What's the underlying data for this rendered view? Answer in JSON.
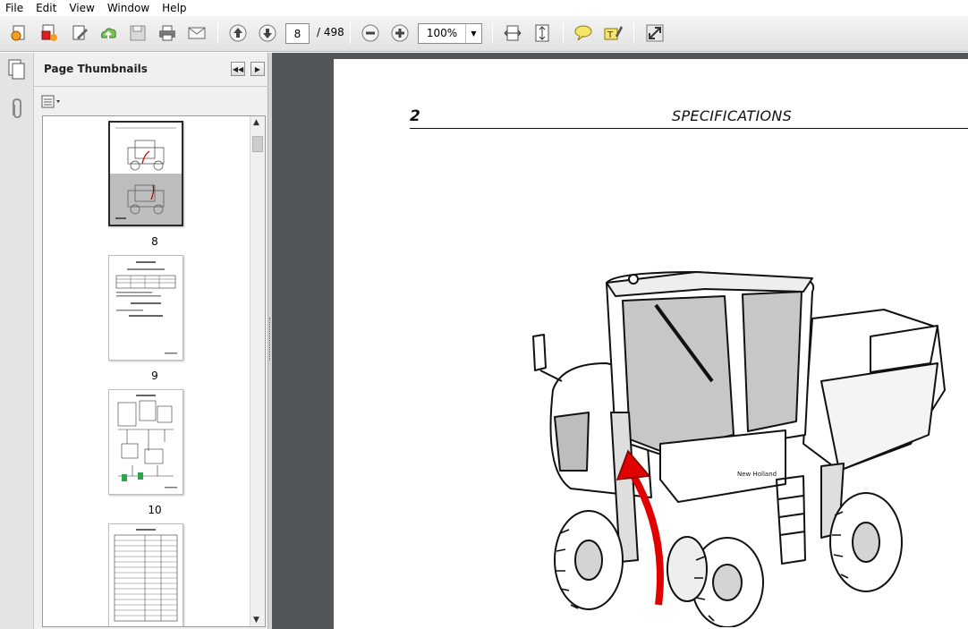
{
  "menu": [
    "File",
    "Edit",
    "View",
    "Window",
    "Help"
  ],
  "toolbar": {
    "current_page": "8",
    "page_total": "/ 498",
    "zoom": "100%"
  },
  "thumbnails": {
    "title": "Page Thumbnails",
    "items": [
      {
        "label": "8",
        "selected": true
      },
      {
        "label": "9",
        "selected": false
      },
      {
        "label": "10",
        "selected": false
      },
      {
        "label": "",
        "selected": false
      }
    ]
  },
  "document": {
    "page_number": "2",
    "heading": "SPECIFICATIONS",
    "cab_model_text": "New Holland"
  },
  "colors": {
    "toolbar_bg": "#e8e8e8",
    "doc_bg": "#525659",
    "arrow_red": "#e00000"
  }
}
